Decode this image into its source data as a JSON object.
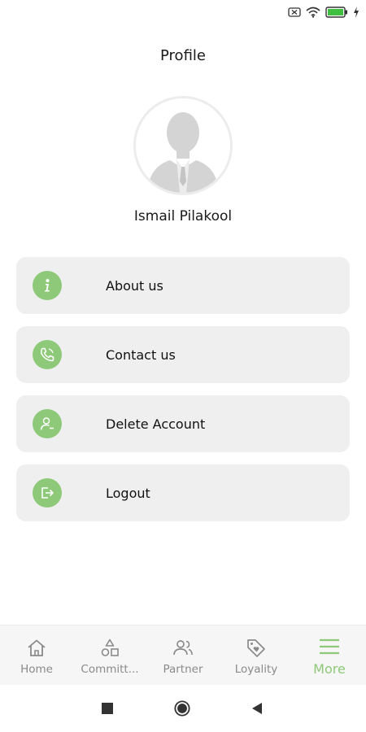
{
  "header": {
    "title": "Profile"
  },
  "profile": {
    "name": "Ismail Pilakool"
  },
  "menu": {
    "items": [
      {
        "label": "About us",
        "icon": "info-icon"
      },
      {
        "label": "Contact us",
        "icon": "phone-icon"
      },
      {
        "label": "Delete Account",
        "icon": "user-remove-icon"
      },
      {
        "label": "Logout",
        "icon": "logout-icon"
      }
    ]
  },
  "bottom_nav": {
    "items": [
      {
        "label": "Home",
        "icon": "home-icon",
        "active": false
      },
      {
        "label": "Committ...",
        "icon": "shapes-icon",
        "active": false
      },
      {
        "label": "Partner",
        "icon": "people-icon",
        "active": false
      },
      {
        "label": "Loyality",
        "icon": "tag-heart-icon",
        "active": false
      },
      {
        "label": "More",
        "icon": "menu-icon",
        "active": true
      }
    ]
  },
  "colors": {
    "accent": "#8ec97a",
    "card_background": "#efefef",
    "battery": "#3fbf3f",
    "inactive_nav": "#8a8a8a"
  }
}
